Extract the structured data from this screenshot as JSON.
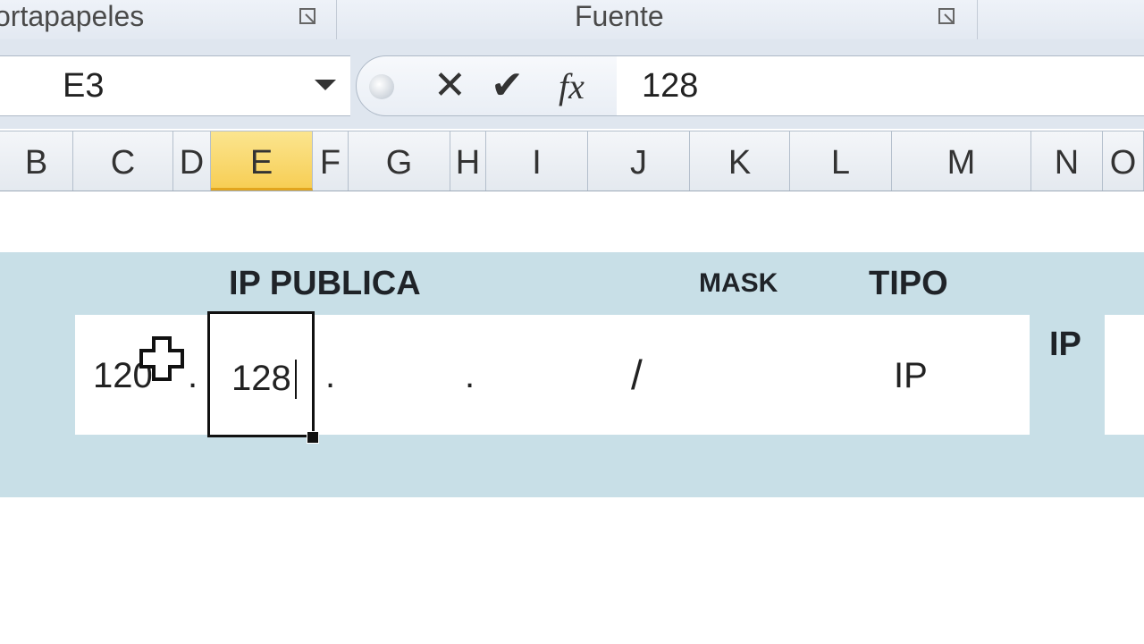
{
  "ribbon": {
    "groups": [
      {
        "label": "ortapapeles"
      },
      {
        "label": "Fuente"
      }
    ]
  },
  "formula_bar": {
    "name_box": "E3",
    "cancel_symbol": "✕",
    "enter_symbol": "✔",
    "fx_symbol": "fx",
    "content": "128"
  },
  "columns": [
    "B",
    "C",
    "D",
    "E",
    "F",
    "G",
    "H",
    "I",
    "J",
    "K",
    "L",
    "M",
    "N",
    "O"
  ],
  "active_column": "E",
  "sheet": {
    "header_ip_publica": "IP PUBLICA",
    "header_mask": "MASK",
    "header_tipo": "TIPO",
    "right_label": "IP",
    "octet1": "120",
    "octet2": "128",
    "dot": ".",
    "slash": "/",
    "tipo_value": "IP"
  },
  "colors": {
    "band": "#c8dfe7",
    "active_header": "#f7ce55"
  },
  "icons": [
    "dialog-launcher-icon",
    "dropdown-arrow-icon",
    "cancel-icon",
    "enter-icon",
    "function-icon",
    "cross-cursor-icon"
  ]
}
